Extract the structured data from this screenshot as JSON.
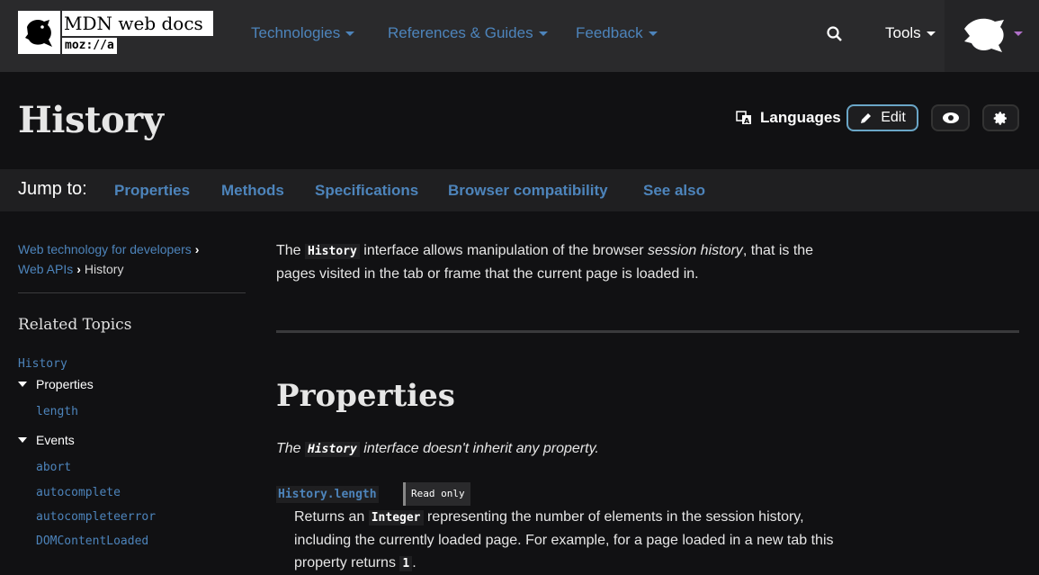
{
  "header": {
    "logo_title": "MDN web docs",
    "logo_moz": "moz://a",
    "nav": [
      "Technologies",
      "References & Guides",
      "Feedback"
    ],
    "tools_label": "Tools"
  },
  "page": {
    "title": "History",
    "languages_label": "Languages",
    "edit_label": "Edit"
  },
  "jump": {
    "label": "Jump to:",
    "links": [
      "Properties",
      "Methods",
      "Specifications",
      "Browser compatibility",
      "See also"
    ]
  },
  "breadcrumb": {
    "items": [
      "Web technology for developers",
      "Web APIs",
      "History"
    ]
  },
  "sidebar": {
    "related_title": "Related Topics",
    "root": "History",
    "sections": [
      {
        "label": "Properties",
        "items": [
          "length"
        ]
      },
      {
        "label": "Events",
        "items": [
          "abort",
          "autocomplete",
          "autocompleteerror",
          "DOMContentLoaded"
        ]
      }
    ]
  },
  "content": {
    "intro_pre": "The ",
    "intro_code": "History",
    "intro_mid": " interface allows manipulation of the browser ",
    "intro_em": "session history",
    "intro_post1": ", that is the",
    "intro_line2": "pages visited in the tab or frame that the current page is loaded in.",
    "properties_heading": "Properties",
    "properties_note_pre": "The ",
    "properties_note_code": "History",
    "properties_note_post": " interface doesn't inherit any property.",
    "prop_name": "History.length",
    "readonly_badge": "Read only",
    "prop_desc_pre": "Returns an ",
    "prop_desc_code": "Integer",
    "prop_desc_post": " representing the number of elements in the session history,",
    "prop_desc_line2": "including the currently loaded page. For example, for a page loaded in a new tab this",
    "prop_desc_line3_pre": "property returns ",
    "prop_desc_line3_code": "1",
    "prop_desc_line3_post": "."
  }
}
